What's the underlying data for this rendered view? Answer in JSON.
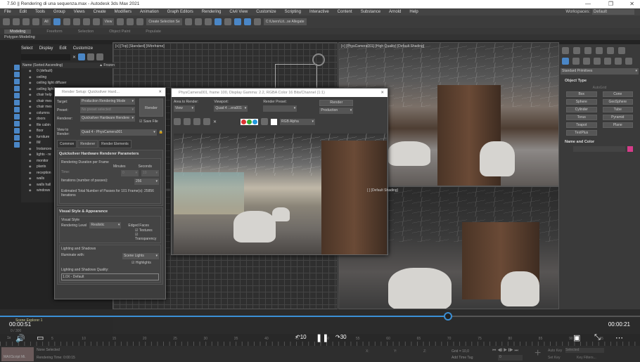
{
  "window": {
    "title": "7.50 || Rendering di una sequenza.max - Autodesk 3ds Max 2021",
    "minimize": "—",
    "maximize": "❐",
    "close": "✕"
  },
  "menu": [
    "File",
    "Edit",
    "Tools",
    "Group",
    "Views",
    "Create",
    "Modifiers",
    "Animation",
    "Graph Editors",
    "Rendering",
    "Civil View",
    "Customize",
    "Scripting",
    "Interactive",
    "Content",
    "Substance",
    "Arnold",
    "Help"
  ],
  "workspace": {
    "label": "Workspaces:",
    "value": "Default"
  },
  "toolbar": {
    "selection_filter": "All",
    "ref_coord": "View",
    "named_selection": "Create Selection Se",
    "project_path": "C:\\Users\\Lit...se Allegate"
  },
  "ribbon": {
    "tabs": [
      "Modeling",
      "Freeform",
      "Selection",
      "Object Paint",
      "Populate"
    ],
    "active": "Modeling",
    "subtitle": "Polygon Modeling"
  },
  "explorer": {
    "menu": [
      "Select",
      "Display",
      "Edit",
      "Customize"
    ],
    "col_name": "Name (Sorted Ascending)",
    "col_frozen": "▲ Frozen",
    "items": [
      "0 (default)",
      "ceiling",
      "ceiling light diffuser",
      "ceiling light",
      "chair help",
      "chair mes",
      "chair mes",
      "columns",
      "doors",
      "file cabin",
      "floor",
      "furniture",
      "IM",
      "Instances",
      "lights - re",
      "monitor",
      "plants",
      "reception",
      "walls",
      "walls hall",
      "windows"
    ],
    "footer": "Scene Explorer 1",
    "frame_counter": "0 / 300"
  },
  "viewports": {
    "top_left": "[+] [Top] [Standard] [Wireframe]",
    "top_right": "[+] [PhysCamera001] [High Quality] [Default Shading]",
    "bottom_right": "[ ] [Default Shading]"
  },
  "render_setup": {
    "title": "Render Setup: Quicksilver Hard...",
    "target_label": "Target:",
    "target": "Production Rendering Mode",
    "preset_label": "Preset:",
    "preset": "No preset selected",
    "renderer_label": "Renderer:",
    "renderer": "Quicksilver Hardware Rendere",
    "save_file": "Save File",
    "view_label": "View to Render:",
    "view": "Quad 4 - PhysCamera001",
    "render_button": "Render",
    "tabs": [
      "Common",
      "Renderer",
      "Render Elements"
    ],
    "active_tab": "Renderer",
    "params_title": "Quicksilver Hardware Renderer Parameters",
    "duration_title": "Rendering Duration per Frame",
    "minutes": "Minutes",
    "seconds": "Seconds",
    "time_label": "Time:",
    "time_min": "0",
    "time_sec": "10",
    "iter_label": "Iterations (number of passes):",
    "iterations": "256",
    "estimate": "Estimated Total Number of Passes for 101 Frame(s): 25856 Iterations",
    "visual_title": "Visual Style & Appearance",
    "visual_style": "Visual Style",
    "level_label": "Rendering Level",
    "level": "Realistic",
    "edged": "Edged Faces",
    "textures": "Textures",
    "transparency": "Transparency",
    "lighting_title": "Lighting and Shadows",
    "illum_label": "Illuminate with:",
    "illum": "Scene Lights",
    "highlights": "Highlights",
    "quality_label": "Lighting and Shadows Quality:",
    "quality": "1.0X - Default"
  },
  "frame_buffer": {
    "title": "PhysCamera001, frame 100, Display Gamma: 2.2, RGBA Color 16 Bits/Channel (1:1)",
    "area_label": "Area to Render:",
    "area": "View",
    "viewport_label": "Viewport:",
    "viewport": "Quad 4 ...era001",
    "preset_label": "Render Preset:",
    "preset": "",
    "render_button": "Render",
    "mode": "Production",
    "channel": "RGB Alpha"
  },
  "command_panel": {
    "category": "Standard Primitives",
    "object_type": "Object Type",
    "autogrid": "AutoGrid",
    "primitives": [
      "Box",
      "Cone",
      "Sphere",
      "GeoSphere",
      "Cylinder",
      "Tube",
      "Torus",
      "Pyramid",
      "Teapot",
      "Plane",
      "TextPlus"
    ],
    "name_color": "Name and Color",
    "color": "#d63c8a"
  },
  "video": {
    "elapsed": "00:00:51",
    "remaining": "00:00:21",
    "progress_percent": 70,
    "speed": "1x",
    "skip_back": "10",
    "skip_fwd": "30",
    "accent": "#3b8fd6"
  },
  "timeline": {
    "ticks": [
      "5",
      "10",
      "15",
      "20",
      "25",
      "30",
      "35",
      "40",
      "45",
      "50",
      "55",
      "60",
      "65",
      "70",
      "75",
      "80",
      "85",
      "90",
      "95"
    ]
  },
  "status": {
    "script": "MAXScript Mi.",
    "selection": "None Selected",
    "render_time": "Rendering Time: 0:00:15",
    "x": "X:",
    "y": "Y:",
    "z": "Z:",
    "grid": "Grid = 10,0",
    "add_tag": "Add Time Tag",
    "auto_key": "Auto Key",
    "selected": "Selected",
    "set_key": "Set Key",
    "key_filters": "Key Filters...",
    "frame": "0"
  }
}
